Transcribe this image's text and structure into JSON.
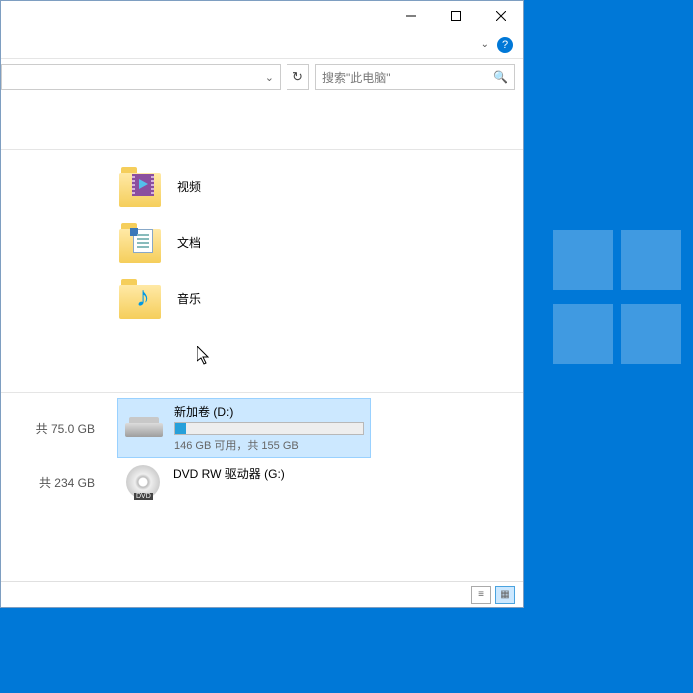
{
  "search": {
    "placeholder": "搜索\"此电脑\""
  },
  "folders": {
    "video": "视频",
    "documents": "文档",
    "music": "音乐"
  },
  "drives": {
    "left1": "共 75.0 GB",
    "left2": "共 234 GB",
    "d": {
      "name": "新加卷 (D:)",
      "sub": "146 GB 可用，共 155 GB",
      "fill_pct": 6
    },
    "g": {
      "name": "DVD RW 驱动器 (G:)"
    }
  }
}
